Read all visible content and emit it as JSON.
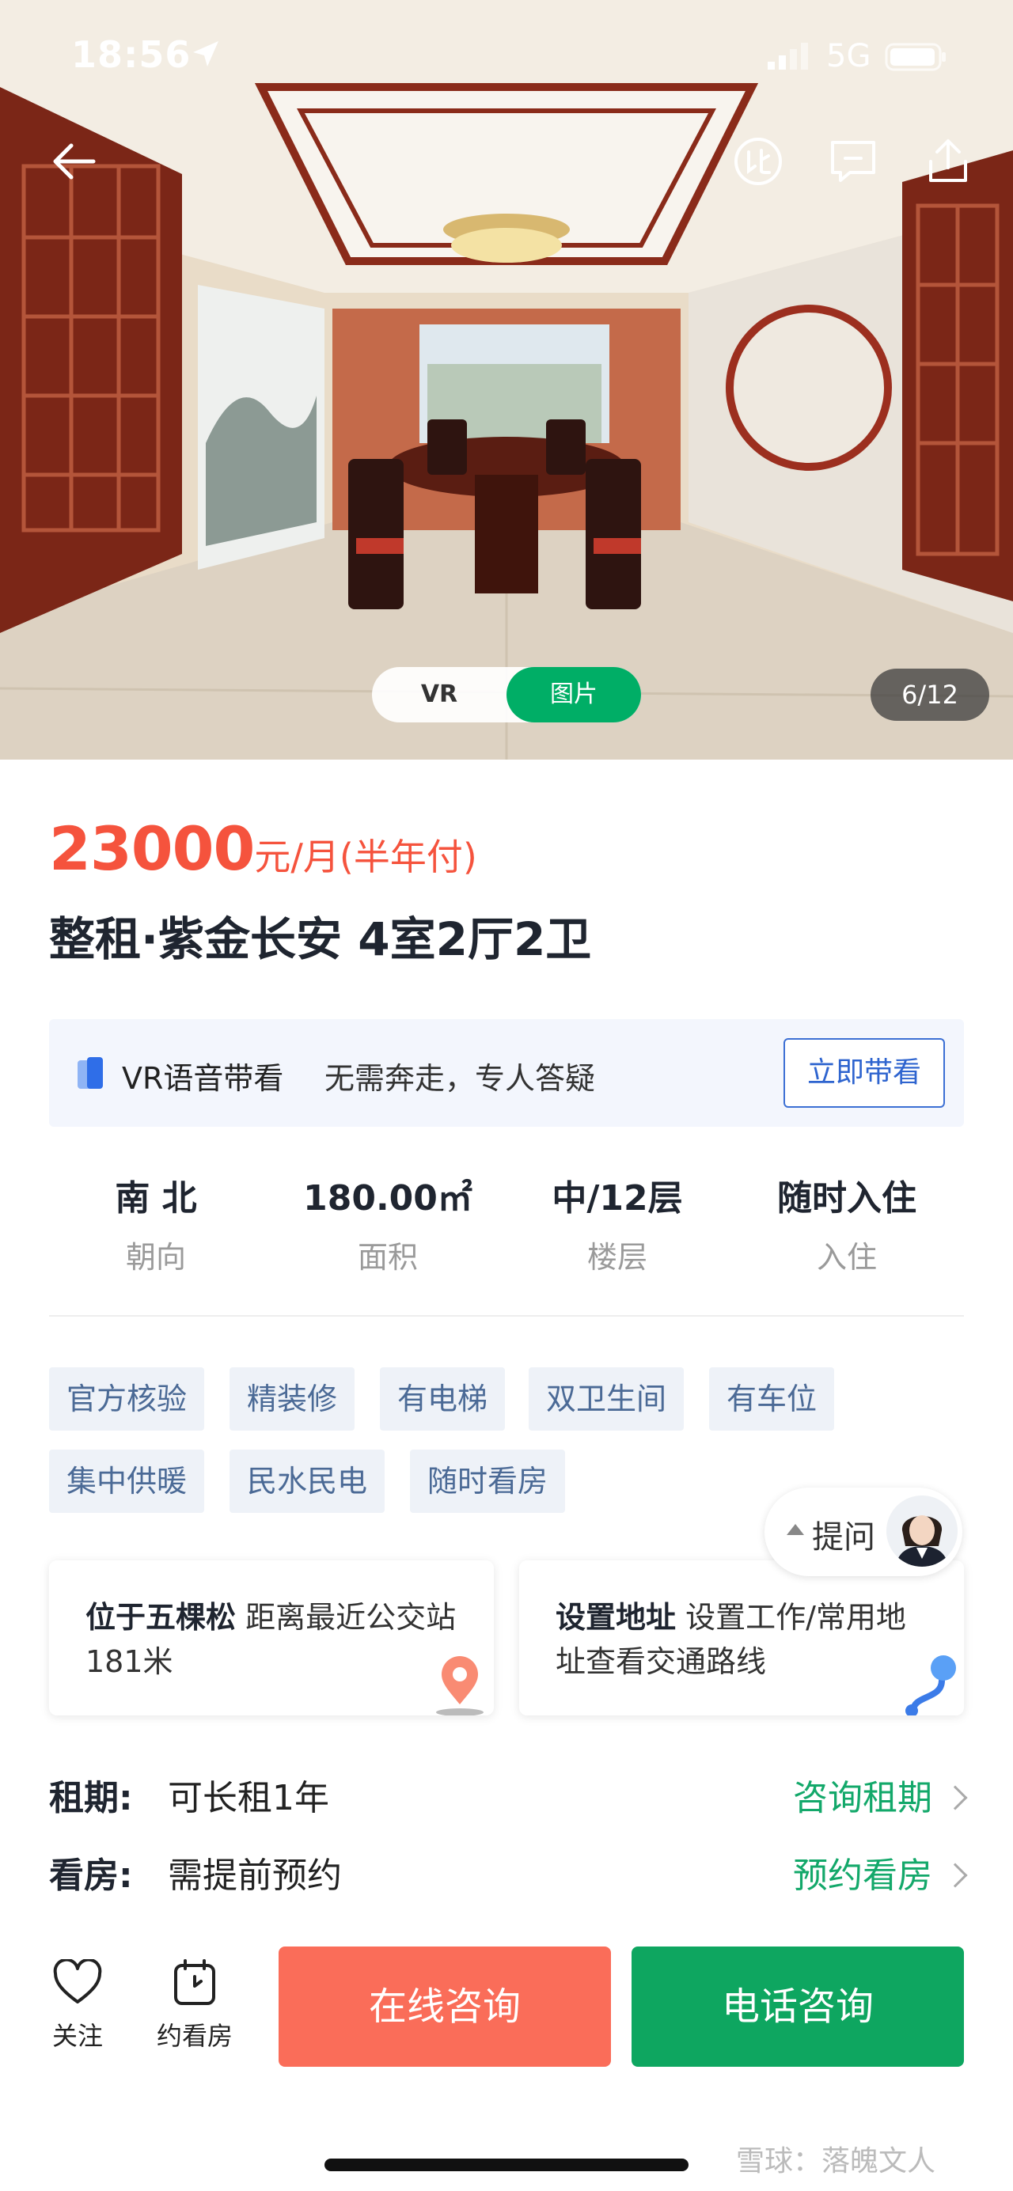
{
  "status_bar": {
    "time": "18:56",
    "network": "5G"
  },
  "gallery": {
    "vr_label": "VR",
    "photo_label": "图片",
    "counter": "6/12"
  },
  "listing": {
    "price_value": "23000",
    "price_unit": "元/月(半年付)",
    "title": "整租·紫金长安 4室2厅2卫"
  },
  "vr_banner": {
    "label": "VR语音带看",
    "description": "无需奔走，专人答疑",
    "button": "立即带看"
  },
  "key_info": [
    {
      "value": "南 北",
      "label": "朝向"
    },
    {
      "value": "180.00㎡",
      "label": "面积"
    },
    {
      "value": "中/12层",
      "label": "楼层"
    },
    {
      "value": "随时入住",
      "label": "入住"
    }
  ],
  "tags": [
    "官方核验",
    "精装修",
    "有电梯",
    "双卫生间",
    "有车位",
    "集中供暖",
    "民水民电",
    "随时看房"
  ],
  "ask_button": {
    "label": "提问"
  },
  "location_cards": [
    {
      "title": "位于五棵松",
      "text": "距离最近公交站181米"
    },
    {
      "title": "设置地址",
      "text": "设置工作/常用地址查看交通路线"
    }
  ],
  "lease": {
    "label": "租期:",
    "value": "可长租1年",
    "link": "咨询租期"
  },
  "viewing": {
    "label": "看房:",
    "value": "需提前预约",
    "link": "预约看房"
  },
  "bottom_bar": {
    "follow": "关注",
    "schedule": "约看房",
    "online": "在线咨询",
    "phone": "电话咨询"
  },
  "watermark": "雪球：落魄文人",
  "colors": {
    "price": "#f5533d",
    "accent_green": "#00ae66",
    "cta_online": "#fa6d59",
    "cta_phone": "#0ea660",
    "vr_blue": "#2e64cf",
    "tag_text": "#4b6a96"
  }
}
